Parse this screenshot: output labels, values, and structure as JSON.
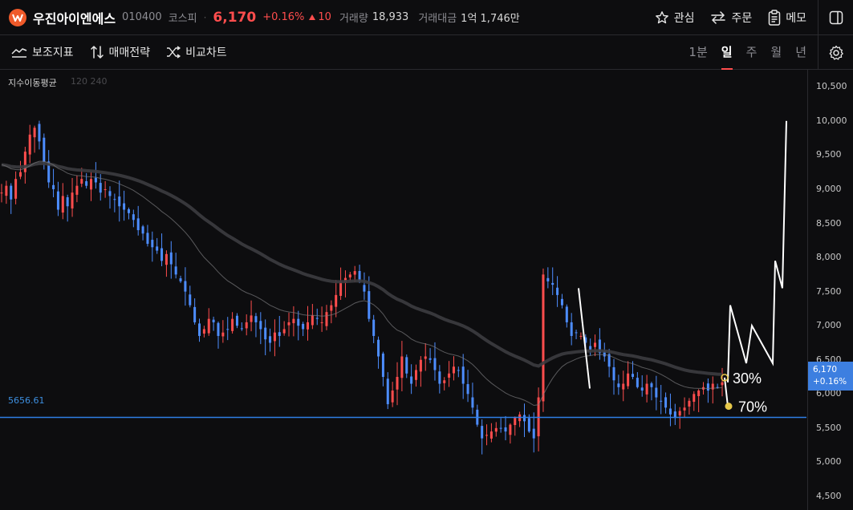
{
  "header": {
    "stock_name": "우진아이엔에스",
    "stock_code": "010400",
    "market": "코스피",
    "price": "6,170",
    "change_pct": "+0.16%",
    "change_abs": "10",
    "volume_label": "거래량",
    "volume_value": "18,933",
    "amount_label": "거래대금",
    "amount_value": "1억 1,746만",
    "actions": {
      "watch": "관심",
      "order": "주문",
      "memo": "메모"
    }
  },
  "toolbar": {
    "indicators": "보조지표",
    "strategy": "매매전략",
    "compare": "비교차트",
    "periods": [
      "1분",
      "일",
      "주",
      "월",
      "년"
    ],
    "active_period": "일"
  },
  "chart_data": {
    "type": "line",
    "y_ticks": [
      "10,500",
      "10,000",
      "9,500",
      "9,000",
      "8,500",
      "8,000",
      "7,500",
      "7,000",
      "6,500",
      "6,000",
      "5,500",
      "5,000",
      "4,500"
    ],
    "ylim": [
      4300,
      10750
    ],
    "indicator_label": "지수이동평균",
    "indicator_params": "120 240",
    "horizontal_level": {
      "value": 5656.61,
      "label": "5656.61",
      "color": "#3d8fe0"
    },
    "current_price": {
      "value": 6170,
      "label": "6,170",
      "change": "+0.16%"
    },
    "close_series": [
      8950,
      9050,
      8850,
      9150,
      9250,
      9550,
      9800,
      9900,
      9700,
      9400,
      9100,
      9000,
      8700,
      8900,
      8750,
      8950,
      9050,
      9150,
      9050,
      9150,
      9100,
      8950,
      9000,
      8900,
      8850,
      8750,
      8700,
      8650,
      8550,
      8400,
      8350,
      8200,
      8150,
      8100,
      7950,
      8050,
      7900,
      7750,
      7650,
      7500,
      7300,
      7050,
      6850,
      6950,
      7100,
      7050,
      6850,
      6900,
      6950,
      7100,
      7000,
      6950,
      7050,
      7150,
      7050,
      6950,
      6800,
      6750,
      6900,
      6850,
      6950,
      7050,
      7100,
      7000,
      6950,
      7050,
      7150,
      7100,
      7050,
      7200,
      7300,
      7450,
      7650,
      7700,
      7750,
      7800,
      7650,
      7500,
      7100,
      6850,
      6550,
      6250,
      5850,
      6050,
      6250,
      6550,
      6300,
      6150,
      6350,
      6500,
      6550,
      6500,
      6350,
      6150,
      6200,
      6300,
      6400,
      6350,
      6150,
      6000,
      5800,
      5550,
      5350,
      5400,
      5450,
      5500,
      5500,
      5450,
      5550,
      5650,
      5700,
      5600,
      5450,
      5350,
      5950,
      7750,
      7650,
      7600,
      7450,
      7300,
      7050,
      6850,
      6900,
      6850,
      6750,
      6650,
      6750,
      6600,
      6550,
      6400,
      6200,
      6100,
      6150,
      6300,
      6250,
      6100,
      6050,
      6150,
      6100,
      5950,
      5900,
      5800,
      5700,
      5650,
      5750,
      5800,
      5900,
      6000,
      6050,
      6100,
      6050,
      6150,
      6100,
      6170
    ],
    "annotation_texts": [
      "30%",
      "70%"
    ],
    "drawing_points": [
      [
        6170,
        6170
      ],
      [
        7300,
        6450
      ],
      [
        7000,
        6450
      ],
      [
        7950,
        7550
      ],
      [
        10000,
        10000
      ]
    ],
    "legend": "none",
    "grid": false
  },
  "colors": {
    "up": "#ff4d4d",
    "down": "#4d8dff",
    "ma_120": "#7a7a7e",
    "ma_240": "#3c3c40",
    "level": "#2f7fe6",
    "drawing": "#ffffff",
    "marker": "#e6c84a"
  }
}
